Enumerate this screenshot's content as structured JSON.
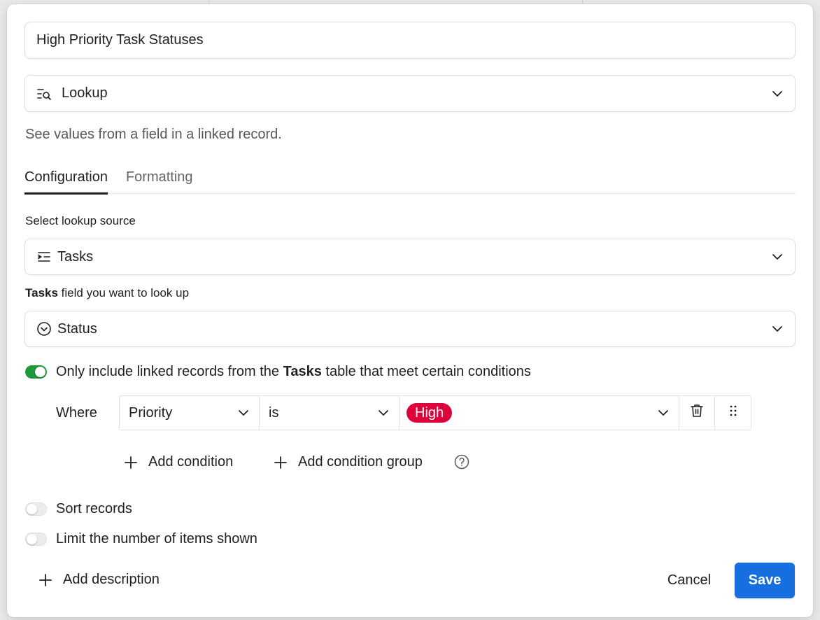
{
  "field_name": {
    "value": "High Priority Task Statuses"
  },
  "field_type": {
    "label": "Lookup",
    "icon": "lookup-icon",
    "description": "See values from a field in a linked record."
  },
  "tabs": [
    {
      "label": "Configuration",
      "active": true
    },
    {
      "label": "Formatting",
      "active": false
    }
  ],
  "lookup_source": {
    "label": "Select lookup source",
    "value": "Tasks",
    "icon": "linked-record-icon"
  },
  "lookup_field": {
    "label_bold": "Tasks",
    "label_rest": " field you want to look up",
    "value": "Status",
    "icon": "single-select-icon"
  },
  "filter_toggle": {
    "on": true,
    "text_before": "Only include linked records from the ",
    "text_bold": "Tasks",
    "text_after": " table that meet certain conditions"
  },
  "condition": {
    "where_label": "Where",
    "field": "Priority",
    "operator": "is",
    "value": "High",
    "value_color": "#dc043b"
  },
  "add_condition_label": "Add condition",
  "add_condition_group_label": "Add condition group",
  "sort_toggle": {
    "on": false,
    "label": "Sort records"
  },
  "limit_toggle": {
    "on": false,
    "label": "Limit the number of items shown"
  },
  "footer": {
    "add_description_label": "Add description",
    "cancel_label": "Cancel",
    "save_label": "Save",
    "save_color": "#166ee1"
  },
  "accent_green": "#1f9b3b"
}
